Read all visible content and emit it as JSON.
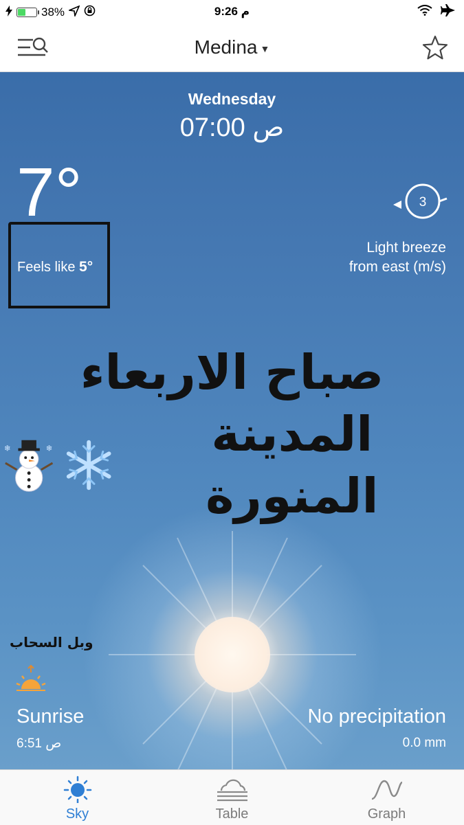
{
  "status_bar": {
    "battery": "38%",
    "battery_level": 0.38,
    "time": "9:26 م"
  },
  "header": {
    "location": "Medina"
  },
  "forecast": {
    "day": "Wednesday",
    "time": "07:00 ص",
    "temperature": "7°",
    "feels_like_label": "Feels like",
    "feels_like_value": "5°",
    "wind_speed": "3",
    "wind_line1": "Light breeze",
    "wind_line2": "from east (m/s)",
    "sunrise_title": "Sunrise",
    "sunrise_time": "6:51 ص",
    "precip_title": "No precipitation",
    "precip_amount": "0.0 mm"
  },
  "overlay": {
    "greeting_line1": "صباح الاربعاء",
    "greeting_line2": "المدينة المنورة",
    "signature": "وبل السحاب"
  },
  "tabs": [
    {
      "label": "Sky",
      "icon": "sun-icon",
      "active": true
    },
    {
      "label": "Table",
      "icon": "cloud-table-icon",
      "active": false
    },
    {
      "label": "Graph",
      "icon": "wave-graph-icon",
      "active": false
    }
  ],
  "colors": {
    "accent": "#2f7fd4",
    "sky_top": "#3a6da9",
    "sky_bottom": "#6a9fcb"
  }
}
